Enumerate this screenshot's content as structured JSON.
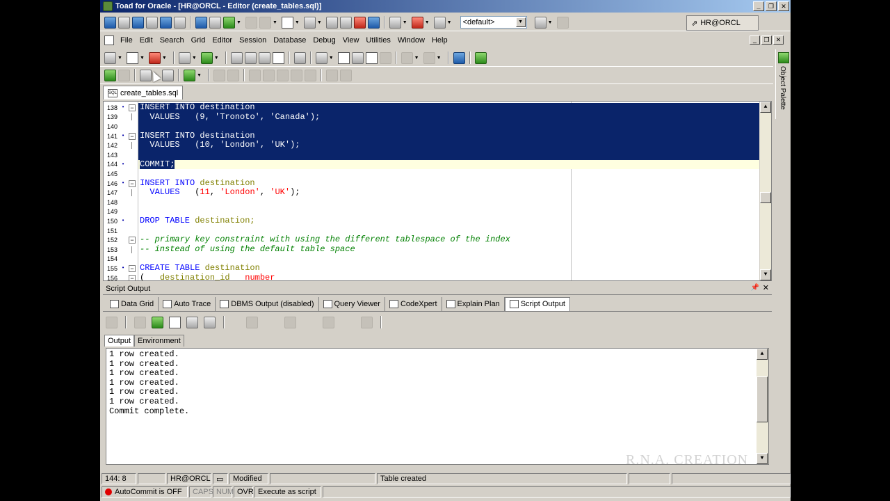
{
  "window": {
    "title": "Toad for Oracle - [HR@ORCL - Editor (create_tables.sql)]",
    "connection_button": "HR@ORCL"
  },
  "toolbar": {
    "schema_combo": "<default>"
  },
  "menu": {
    "items": [
      "File",
      "Edit",
      "Search",
      "Grid",
      "Editor",
      "Session",
      "Database",
      "Debug",
      "View",
      "Utilities",
      "Window",
      "Help"
    ]
  },
  "palette": {
    "label": "Object Palette"
  },
  "editor": {
    "tab_label": "create_tables.sql",
    "lines": [
      {
        "n": "138",
        "marker": "•",
        "fold": "box"
      },
      {
        "n": "139",
        "marker": "",
        "fold": "bar"
      },
      {
        "n": "140",
        "marker": "",
        "fold": ""
      },
      {
        "n": "141",
        "marker": "•",
        "fold": "box"
      },
      {
        "n": "142",
        "marker": "",
        "fold": "bar"
      },
      {
        "n": "143",
        "marker": "",
        "fold": ""
      },
      {
        "n": "144",
        "marker": "•",
        "fold": ""
      },
      {
        "n": "145",
        "marker": "",
        "fold": ""
      },
      {
        "n": "146",
        "marker": "•",
        "fold": "box"
      },
      {
        "n": "147",
        "marker": "",
        "fold": "bar"
      },
      {
        "n": "148",
        "marker": "",
        "fold": ""
      },
      {
        "n": "149",
        "marker": "",
        "fold": ""
      },
      {
        "n": "150",
        "marker": "•",
        "fold": ""
      },
      {
        "n": "151",
        "marker": "",
        "fold": ""
      },
      {
        "n": "152",
        "marker": "",
        "fold": "box"
      },
      {
        "n": "153",
        "marker": "",
        "fold": "bar"
      },
      {
        "n": "154",
        "marker": "",
        "fold": ""
      },
      {
        "n": "155",
        "marker": "•",
        "fold": "box"
      },
      {
        "n": "156",
        "marker": "",
        "fold": "box"
      }
    ],
    "code": {
      "l138_kw": "INSERT INTO",
      "l138_id": "destination",
      "l139_kw": "  VALUES",
      "l139_a": "   (",
      "l139_num": "9",
      "l139_b": ", ",
      "l139_s1": "'Tronoto'",
      "l139_c": ", ",
      "l139_s2": "'Canada'",
      "l139_d": ");",
      "l141_kw": "INSERT INTO",
      "l141_id": "destination",
      "l142_kw": "  VALUES",
      "l142_a": "   (",
      "l142_num": "10",
      "l142_b": ", ",
      "l142_s1": "'London'",
      "l142_c": ", ",
      "l142_s2": "'UK'",
      "l142_d": ");",
      "l144_kw": "COMMIT;",
      "l146_kw": "INSERT INTO",
      "l146_id": "destination",
      "l147_kw": "  VALUES",
      "l147_a": "   (",
      "l147_num": "11",
      "l147_b": ", ",
      "l147_s1": "'London'",
      "l147_c": ", ",
      "l147_s2": "'UK'",
      "l147_d": ");",
      "l150_kw": "DROP TABLE",
      "l150_id": "destination;",
      "l152_cm": "-- primary key constraint with using the different tablespace of the index",
      "l153_cm": "-- instead of using the default table space",
      "l155_kw": "CREATE TABLE",
      "l155_id": "destination",
      "l156_a": "(   ",
      "l156_id": "destination_id",
      "l156_b": "   ",
      "l156_kw": "number"
    }
  },
  "script_output": {
    "panel_title": "Script Output",
    "tabs": [
      "Data Grid",
      "Auto Trace",
      "DBMS Output (disabled)",
      "Query Viewer",
      "CodeXpert",
      "Explain Plan",
      "Script Output"
    ],
    "subtabs": [
      "Output",
      "Environment"
    ],
    "lines": [
      "1 row created.",
      "1 row created.",
      "1 row created.",
      "1 row created.",
      "1 row created.",
      "1 row created.",
      "Commit complete."
    ]
  },
  "watermark": "R.N.A. CREATION",
  "status": {
    "position": "144:  8",
    "connection": "HR@ORCL",
    "modified": "Modified",
    "message": "Table created",
    "autocommit": "AutoCommit is OFF",
    "caps": "CAPS",
    "num": "NUM",
    "ovr": "OVR",
    "exec_mode": "Execute as script"
  }
}
